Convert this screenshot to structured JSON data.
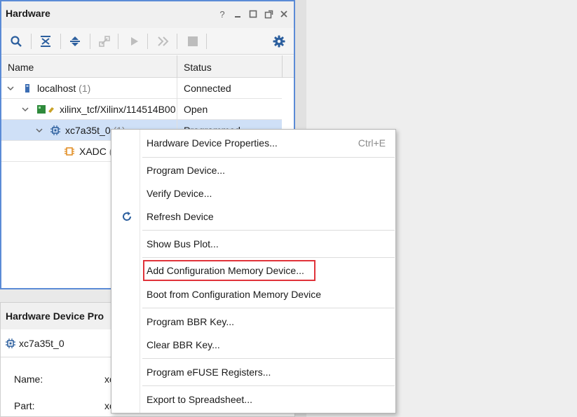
{
  "hardware_panel": {
    "title": "Hardware",
    "window_controls": {
      "help": "?",
      "minimize": "–",
      "maximize": "□",
      "float": "⧉",
      "close": "✕"
    },
    "columns": {
      "name": "Name",
      "status": "Status"
    },
    "rows": [
      {
        "name": "localhost",
        "count": "(1)",
        "status": "Connected"
      },
      {
        "name": "xilinx_tcf/Xilinx/114514B00",
        "count": "",
        "status": "Open"
      },
      {
        "name": "xc7a35t_0",
        "count": "(1)",
        "status": "Programmed"
      },
      {
        "name": "XADC",
        "count": "(",
        "status": ""
      }
    ]
  },
  "properties_panel": {
    "title": "Hardware Device Pro",
    "device": "xc7a35t_0",
    "fields": [
      {
        "label": "Name:",
        "value": "xc"
      },
      {
        "label": "Part:",
        "value": "xc"
      }
    ]
  },
  "context_menu": {
    "items": [
      {
        "label": "Hardware Device Properties...",
        "shortcut": "Ctrl+E"
      },
      {
        "label": "Program Device..."
      },
      {
        "label": "Verify Device..."
      },
      {
        "label": "Refresh Device"
      },
      {
        "label": "Show Bus Plot..."
      },
      {
        "label": "Add Configuration Memory Device..."
      },
      {
        "label": "Boot from Configuration Memory Device"
      },
      {
        "label": "Program BBR Key..."
      },
      {
        "label": "Clear BBR Key..."
      },
      {
        "label": "Program eFUSE Registers..."
      },
      {
        "label": "Export to Spreadsheet..."
      }
    ]
  },
  "colors": {
    "accent_border": "#5b8bd6",
    "selection": "#cfe0f7",
    "highlight_box": "#e0333a",
    "icon_blue": "#2c5f9e"
  }
}
